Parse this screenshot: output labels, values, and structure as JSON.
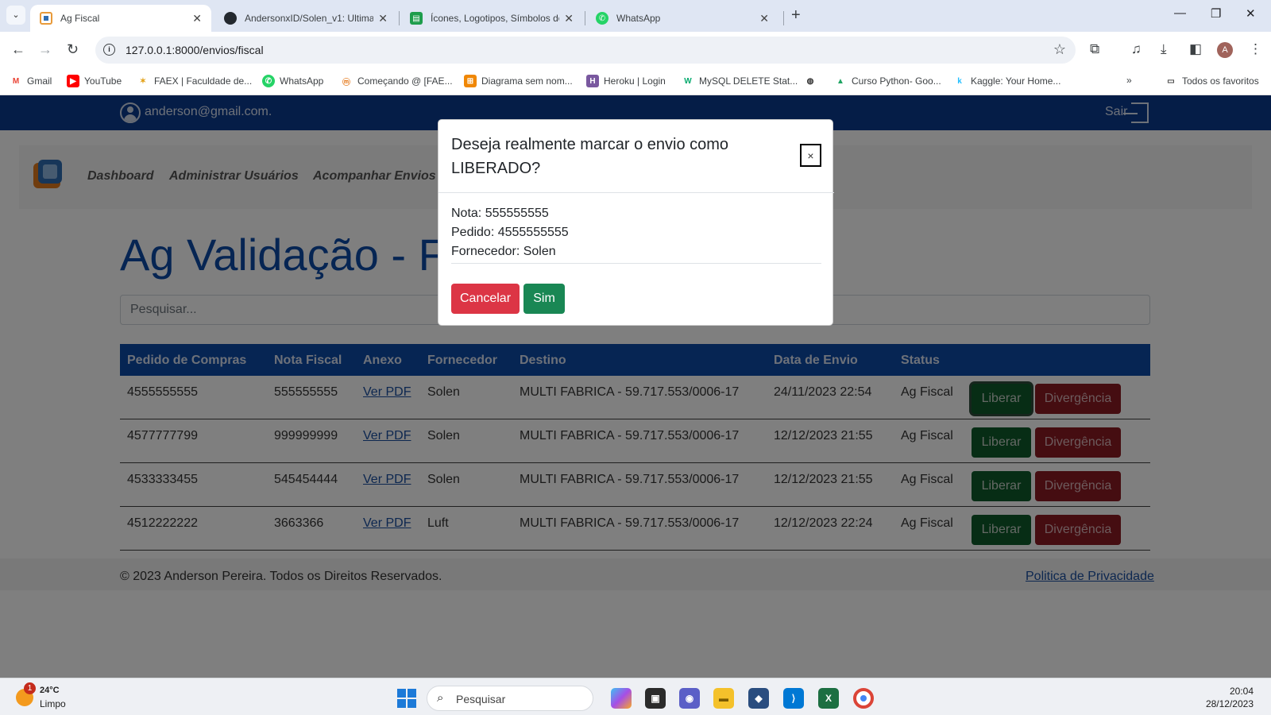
{
  "browser": {
    "tabs": [
      {
        "title": "Ag Fiscal",
        "icon": "blue-square-favicon",
        "active": true
      },
      {
        "title": "AndersonxID/Solen_v1: Ultima v",
        "icon": "github-icon",
        "active": false
      },
      {
        "title": "Ícones, Logotipos, Símbolos de",
        "icon": "green-sheet-icon",
        "active": false
      },
      {
        "title": "WhatsApp",
        "icon": "whatsapp-icon",
        "active": false
      }
    ],
    "url": "127.0.0.1:8000/envios/fiscal",
    "bookmarks": [
      {
        "label": "Gmail",
        "icon": "gmail-icon"
      },
      {
        "label": "YouTube",
        "icon": "youtube-icon"
      },
      {
        "label": "FAEX | Faculdade de...",
        "icon": "faex-icon"
      },
      {
        "label": "WhatsApp",
        "icon": "whatsapp-icon"
      },
      {
        "label": "Começando @ [FAE...",
        "icon": "moodle-icon"
      },
      {
        "label": "Diagrama sem nom...",
        "icon": "drawio-icon"
      },
      {
        "label": "Heroku | Login",
        "icon": "heroku-icon"
      },
      {
        "label": "MySQL DELETE Stat...",
        "icon": "w3schools-icon"
      },
      {
        "label": "",
        "icon": "globe-icon"
      },
      {
        "label": "Curso Python- Goo...",
        "icon": "google-drive-icon"
      },
      {
        "label": "Kaggle: Your Home...",
        "icon": "kaggle-icon"
      }
    ],
    "all_bookmarks": "Todos os favoritos"
  },
  "app": {
    "user_email": "anderson@gmail.com.",
    "logout_label": "Sair",
    "nav": [
      "Dashboard",
      "Administrar Usuários",
      "Acompanhar Envios"
    ],
    "page_title": "Ag Validação - Fiscal",
    "search_placeholder": "Pesquisar...",
    "table": {
      "headers": [
        "Pedido de Compras",
        "Nota Fiscal",
        "Anexo",
        "Fornecedor",
        "Destino",
        "Data de Envio",
        "Status"
      ],
      "rows": [
        {
          "pedido": "4555555555",
          "nota": "555555555",
          "anexo": "Ver PDF",
          "fornecedor": "Solen",
          "destino": "MULTI FABRICA - 59.717.553/0006-17",
          "data": "24/11/2023 22:54",
          "status": "Ag Fiscal"
        },
        {
          "pedido": "4577777799",
          "nota": "999999999",
          "anexo": "Ver PDF",
          "fornecedor": "Solen",
          "destino": "MULTI FABRICA - 59.717.553/0006-17",
          "data": "12/12/2023 21:55",
          "status": "Ag Fiscal"
        },
        {
          "pedido": "4533333455",
          "nota": "545454444",
          "anexo": "Ver PDF",
          "fornecedor": "Solen",
          "destino": "MULTI FABRICA - 59.717.553/0006-17",
          "data": "12/12/2023 21:55",
          "status": "Ag Fiscal"
        },
        {
          "pedido": "4512222222",
          "nota": "3663366",
          "anexo": "Ver PDF",
          "fornecedor": "Luft",
          "destino": "MULTI FABRICA - 59.717.553/0006-17",
          "data": "12/12/2023 22:24",
          "status": "Ag Fiscal"
        }
      ],
      "liberar_label": "Liberar",
      "divergencia_label": "Divergência"
    },
    "footer": {
      "copyright": "© 2023 Anderson Pereira. Todos os Direitos Reservados.",
      "privacy": "Politica de Privacidade"
    }
  },
  "modal": {
    "title": "Deseja realmente marcar o envio como LIBERADO?",
    "close": "×",
    "nota": "Nota: 555555555",
    "pedido": "Pedido: 4555555555",
    "fornecedor": "Fornecedor: Solen",
    "cancel": "Cancelar",
    "confirm": "Sim"
  },
  "taskbar": {
    "weather_temp": "24°C",
    "weather_cond": "Limpo",
    "weather_badge": "1",
    "search_label": "Pesquisar",
    "time": "20:04",
    "date": "28/12/2023"
  },
  "colors": {
    "brand_blue": "#0d4aa6",
    "topbar_blue": "#0b3a8f",
    "liberar_green": "#198754",
    "divergencia_red": "#dc3545"
  }
}
